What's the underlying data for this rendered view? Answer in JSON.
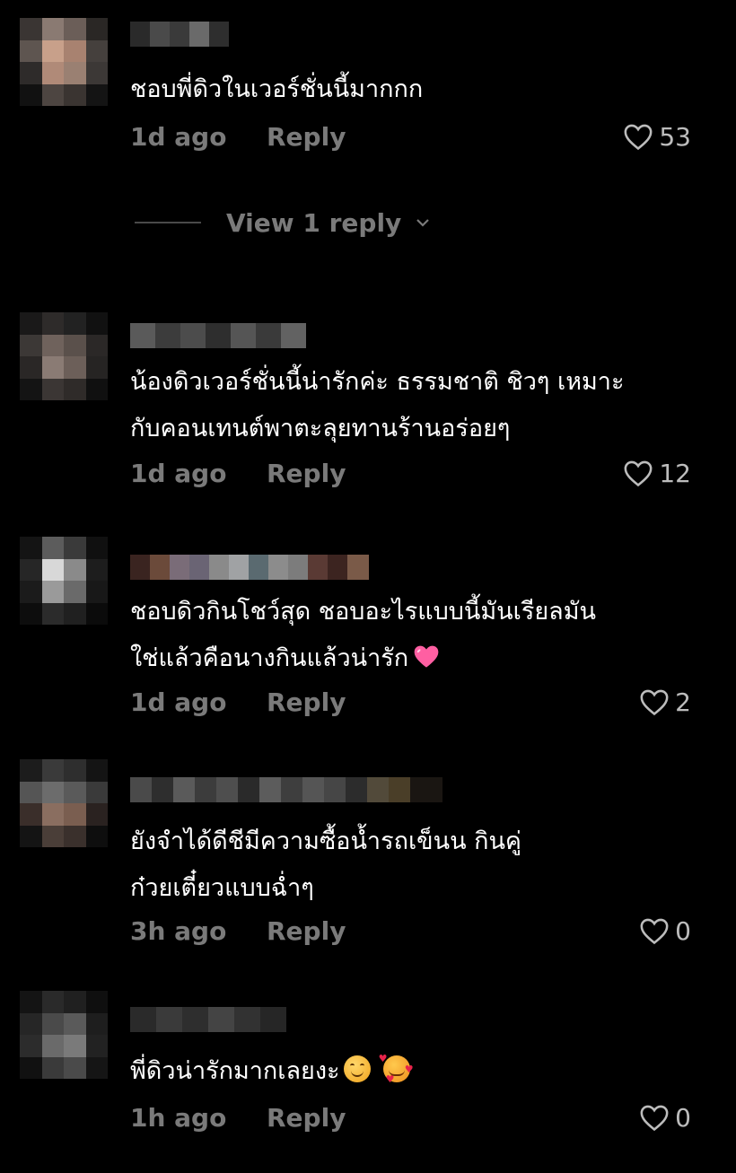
{
  "comments": [
    {
      "text_lines": [
        "ชอบพี่ดิวในเวอร์ชั่นนี้มากกก"
      ],
      "time": "1d ago",
      "reply_label": "Reply",
      "likes": "53",
      "view_replies_label": "View 1 reply"
    },
    {
      "text_lines": [
        "น้องดิวเวอร์ชั่นนี้น่ารักค่ะ ธรรมชาติ ชิวๆ เหมาะ",
        "กับคอนเทนต์พาตะลุยทานร้านอร่อยๆ"
      ],
      "time": "1d ago",
      "reply_label": "Reply",
      "likes": "12"
    },
    {
      "text_lines": [
        "ชอบดิวกินโชว์สุด ชอบอะไรแบบนี้มันเรียลมัน",
        "ใช่แล้วคือนางกินแล้วน่ารัก"
      ],
      "emoji": [
        "pink-heart"
      ],
      "time": "1d ago",
      "reply_label": "Reply",
      "likes": "2"
    },
    {
      "text_lines": [
        "ยังจำได้ดีชีมีความซื้อน้ำรถเข็นน กินคู่",
        "ก๋วยเตี๋ยวแบบฉ่ำๆ"
      ],
      "time": "3h ago",
      "reply_label": "Reply",
      "likes": "0"
    },
    {
      "text_lines": [
        "พี่ดิวน่ารักมากเลยงะ"
      ],
      "emoji": [
        "smiling-face",
        "smiling-face-with-hearts"
      ],
      "time": "1h ago",
      "reply_label": "Reply",
      "likes": "0"
    }
  ],
  "icons": {
    "like": "heart-outline-icon",
    "expand": "chevron-down-icon"
  },
  "colors": {
    "background": "#000000",
    "text": "#ffffff",
    "meta": "#7a7a7a",
    "likes": "#bcbcbc",
    "pink_heart": "#ff5fa2"
  }
}
